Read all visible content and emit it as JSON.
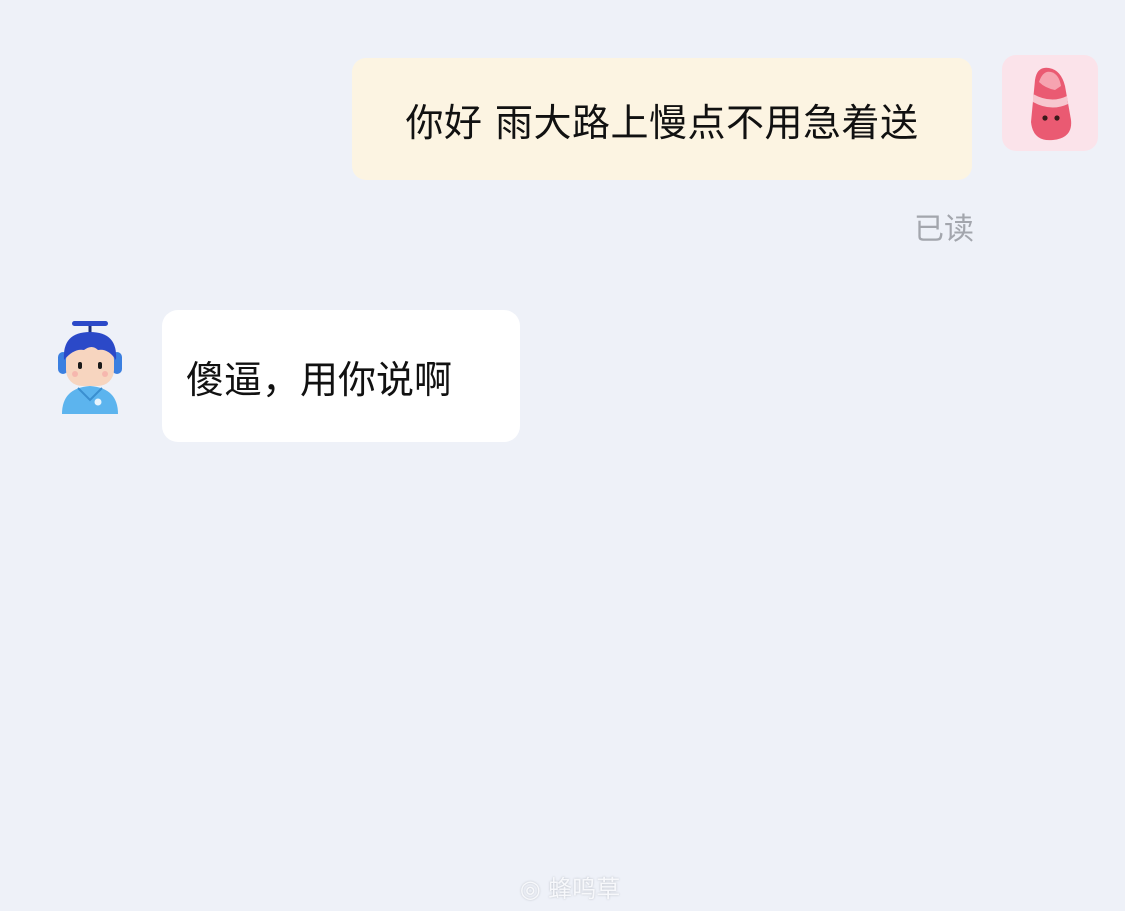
{
  "messages": {
    "outgoing": {
      "text": "你好 雨大路上慢点不用急着送",
      "status": "已读",
      "avatar_icon": "pink-blob-avatar-icon",
      "bubble_color": "#fcf4e2"
    },
    "incoming": {
      "text": "傻逼，用你说啊",
      "avatar_icon": "propeller-boy-avatar-icon",
      "bubble_color": "#ffffff"
    }
  },
  "watermark": {
    "text": "◎ 蜂鸣草"
  },
  "colors": {
    "background": "#eef1f8",
    "status_text": "#a3a6ad"
  }
}
